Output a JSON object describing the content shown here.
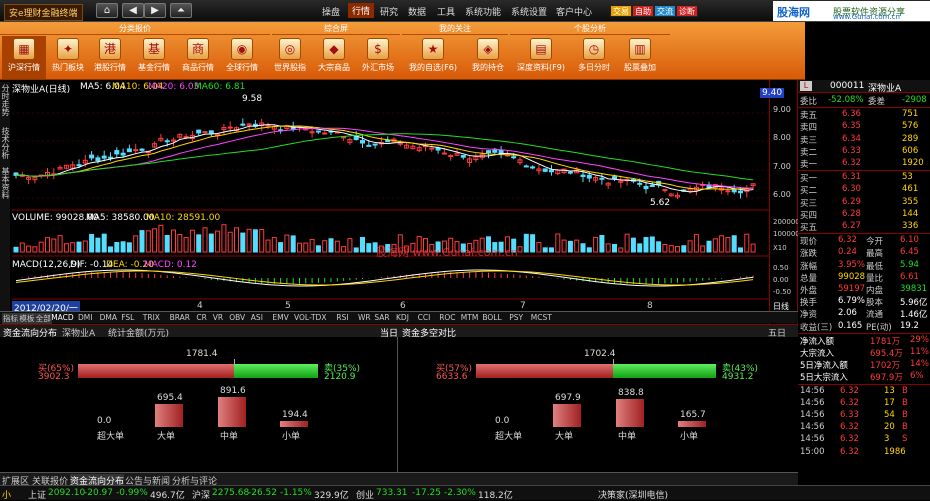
{
  "app": {
    "title": "安e理财金融终端"
  },
  "nav": {
    "home": "⌂",
    "back": "◀",
    "fwd": "▶",
    "up": "⏶"
  },
  "menu": [
    "操盘",
    "行情",
    "研究",
    "数据",
    "工具",
    "系统功能",
    "系统设置",
    "客户中心"
  ],
  "special_btns": [
    {
      "label": "交易",
      "color": "#e8a000"
    },
    {
      "label": "自助",
      "color": "#cc2222"
    },
    {
      "label": "交流",
      "color": "#2288cc"
    },
    {
      "label": "诊断",
      "color": "#cc2222"
    }
  ],
  "brand": {
    "name": "股海网",
    "slogan": "股票软件资源分享",
    "url": "www.Guhai.com.cn"
  },
  "toolbar": {
    "groups": [
      "分类报价",
      "综合屏",
      "我的关注",
      "个股分析"
    ],
    "buttons": [
      {
        "label": "沪深行情",
        "icon": "grid-icon"
      },
      {
        "label": "热门板块",
        "icon": "flame-icon"
      },
      {
        "label": "港股行情",
        "icon": "hk-icon"
      },
      {
        "label": "基金行情",
        "icon": "fund-icon"
      },
      {
        "label": "商品行情",
        "icon": "commodity-icon"
      },
      {
        "label": "全球行情",
        "icon": "globe-icon"
      },
      {
        "label": "世界股指",
        "icon": "world-icon"
      },
      {
        "label": "大宗商品",
        "icon": "gold-icon"
      },
      {
        "label": "外汇市场",
        "icon": "fx-icon"
      },
      {
        "label": "我的自选(F6)",
        "icon": "star-icon"
      },
      {
        "label": "我的持仓",
        "icon": "wallet-icon"
      },
      {
        "label": "深度资料(F9)",
        "icon": "book-icon"
      },
      {
        "label": "多日分时",
        "icon": "clock-icon"
      },
      {
        "label": "股票叠加",
        "icon": "overlay-icon"
      }
    ]
  },
  "chart": {
    "left_tabs": [
      "分时走势",
      "技术分析",
      "基本资料"
    ],
    "header": {
      "name": "深物业A(日线)",
      "ma5": "MA5: 6.04",
      "ma10": "MA10: 6.04",
      "ma20": "MA20: 6.03",
      "ma60": "MA60: 6.81"
    },
    "high_label": "9.58",
    "low_label": "5.62",
    "price_tag": "9.40",
    "yticks": [
      "9.00",
      "8.00",
      "7.00",
      "6.00"
    ],
    "vol_header": {
      "label": "VOLUME: 99028.00",
      "ma5": "MA5: 38580.00",
      "ma10": "MA10: 28591.00"
    },
    "vol_ticks": [
      "200000",
      "100000",
      "X10"
    ],
    "macd_header": {
      "label": "MACD(12,26,9)",
      "dif": "DIF: -0.14",
      "dea": "DEA: -0.20",
      "macd": "MACD: 0.12"
    },
    "macd_ticks": [
      "0.50",
      "0.00",
      "-0.50"
    ],
    "xaxis": [
      "2012/02/20/一",
      "4",
      "5",
      "6",
      "7",
      "8"
    ],
    "xaxis_right": "日线",
    "watermark": "股海网 www.Guhai.com.cn",
    "indicator_tabs": [
      "指标",
      "模板",
      "全部",
      "MACD",
      "DMI",
      "DMA",
      "FSL",
      "TRIX",
      "BRAR",
      "CR",
      "VR",
      "OBV",
      "ASI",
      "EMV",
      "VOL-TDX",
      "RSI",
      "WR",
      "SAR",
      "KDJ",
      "CCI",
      "ROC",
      "MTM",
      "BOLL",
      "PSY",
      "MCST"
    ]
  },
  "lower": {
    "tabs_left": [
      "资金流向分布",
      "深物业A",
      "统计金额(万元)"
    ],
    "tab_right1": "当日",
    "tabs_right": [
      "资金多空对比"
    ],
    "tab_right2": "五日",
    "left": {
      "total": "1781.4",
      "buy_label": "买(65%)",
      "buy_val": "3902.3",
      "sell_label": "卖(35%)",
      "sell_val": "2120.9",
      "buy_pct": 0.65,
      "bars": [
        {
          "label": "超大单",
          "val": "0.0",
          "h": 0
        },
        {
          "label": "大单",
          "val": "695.4",
          "h": 695.4
        },
        {
          "label": "中单",
          "val": "891.6",
          "h": 891.6
        },
        {
          "label": "小单",
          "val": "194.4",
          "h": 194.4
        }
      ]
    },
    "right": {
      "total": "1702.4",
      "buy_label": "买(57%)",
      "buy_val": "6633.6",
      "sell_label": "卖(43%)",
      "sell_val": "4931.2",
      "buy_pct": 0.57,
      "bars": [
        {
          "label": "超大单",
          "val": "0.0",
          "h": 0
        },
        {
          "label": "大单",
          "val": "697.9",
          "h": 697.9
        },
        {
          "label": "中单",
          "val": "838.8",
          "h": 838.8
        },
        {
          "label": "小单",
          "val": "165.7",
          "h": 165.7
        }
      ]
    }
  },
  "bottom_tabs": [
    "扩展区",
    "关联报价",
    "资金流向分布",
    "公告与新闻",
    "分析与评论"
  ],
  "quote": {
    "code": "000011",
    "name": "深物业A",
    "weibi": {
      "l": "委比",
      "v": "-52.08%",
      "l2": "委差",
      "v2": "-2908"
    },
    "sells": [
      {
        "l": "卖五",
        "p": "6.36",
        "v": "751"
      },
      {
        "l": "卖四",
        "p": "6.35",
        "v": "576"
      },
      {
        "l": "卖三",
        "p": "6.34",
        "v": "289"
      },
      {
        "l": "卖二",
        "p": "6.33",
        "v": "606"
      },
      {
        "l": "卖一",
        "p": "6.32",
        "v": "1920"
      }
    ],
    "buys": [
      {
        "l": "买一",
        "p": "6.31",
        "v": "53"
      },
      {
        "l": "买二",
        "p": "6.30",
        "v": "461"
      },
      {
        "l": "买三",
        "p": "6.29",
        "v": "355"
      },
      {
        "l": "买四",
        "p": "6.28",
        "v": "144"
      },
      {
        "l": "买五",
        "p": "6.27",
        "v": "336"
      }
    ],
    "stats": [
      {
        "l": "现价",
        "v": "6.32",
        "l2": "今开",
        "v2": "6.10",
        "c": "red",
        "c2": "red"
      },
      {
        "l": "涨跌",
        "v": "0.24",
        "l2": "最高",
        "v2": "6.45",
        "c": "red",
        "c2": "red"
      },
      {
        "l": "涨幅",
        "v": "3.95%",
        "l2": "最低",
        "v2": "5.94",
        "c": "red",
        "c2": "green"
      },
      {
        "l": "总量",
        "v": "99028",
        "l2": "量比",
        "v2": "6.61",
        "c": "yel",
        "c2": "red"
      },
      {
        "l": "外盘",
        "v": "59197",
        "l2": "内盘",
        "v2": "39831",
        "c": "red",
        "c2": "green"
      },
      {
        "l": "换手",
        "v": "6.79%",
        "l2": "股本",
        "v2": "5.96亿",
        "c": "wht",
        "c2": "wht"
      },
      {
        "l": "净资",
        "v": "2.06",
        "l2": "流通",
        "v2": "1.46亿",
        "c": "wht",
        "c2": "wht"
      },
      {
        "l": "收益(三)",
        "v": "0.165",
        "l2": "PE(动)",
        "v2": "19.2",
        "c": "wht",
        "c2": "wht"
      }
    ],
    "flows": [
      {
        "l": "净流入额",
        "v": "1781万",
        "p": "29%"
      },
      {
        "l": "大宗流入",
        "v": "695.4万",
        "p": "11%"
      },
      {
        "l": "5日净流入额",
        "v": "1702万",
        "p": "14%"
      },
      {
        "l": "5日大宗流入",
        "v": "697.9万",
        "p": "6%"
      }
    ],
    "ticks": [
      {
        "t": "14:56",
        "p": "6.32",
        "v": "13",
        "d": "B"
      },
      {
        "t": "14:56",
        "p": "6.32",
        "v": "17",
        "d": "B"
      },
      {
        "t": "14:56",
        "p": "6.33",
        "v": "54",
        "d": "B"
      },
      {
        "t": "14:56",
        "p": "6.32",
        "v": "20",
        "d": "B"
      },
      {
        "t": "14:56",
        "p": "6.32",
        "v": "3",
        "d": "S"
      },
      {
        "t": "15:00",
        "p": "6.32",
        "v": "1986",
        "d": ""
      }
    ]
  },
  "status": {
    "items": [
      {
        "l": "上证",
        "v": "2092.10",
        "c": "-20.97",
        "p": "-0.99%",
        "a": "496.7亿"
      },
      {
        "l": "沪深",
        "v": "2275.68",
        "c": "-26.52",
        "p": "-1.15%",
        "a": "329.9亿"
      },
      {
        "l": "创业",
        "v": "733.31",
        "c": "-17.25",
        "p": "-2.30%",
        "a": "118.2亿"
      }
    ],
    "msg": "决策家(深圳电信)"
  }
}
